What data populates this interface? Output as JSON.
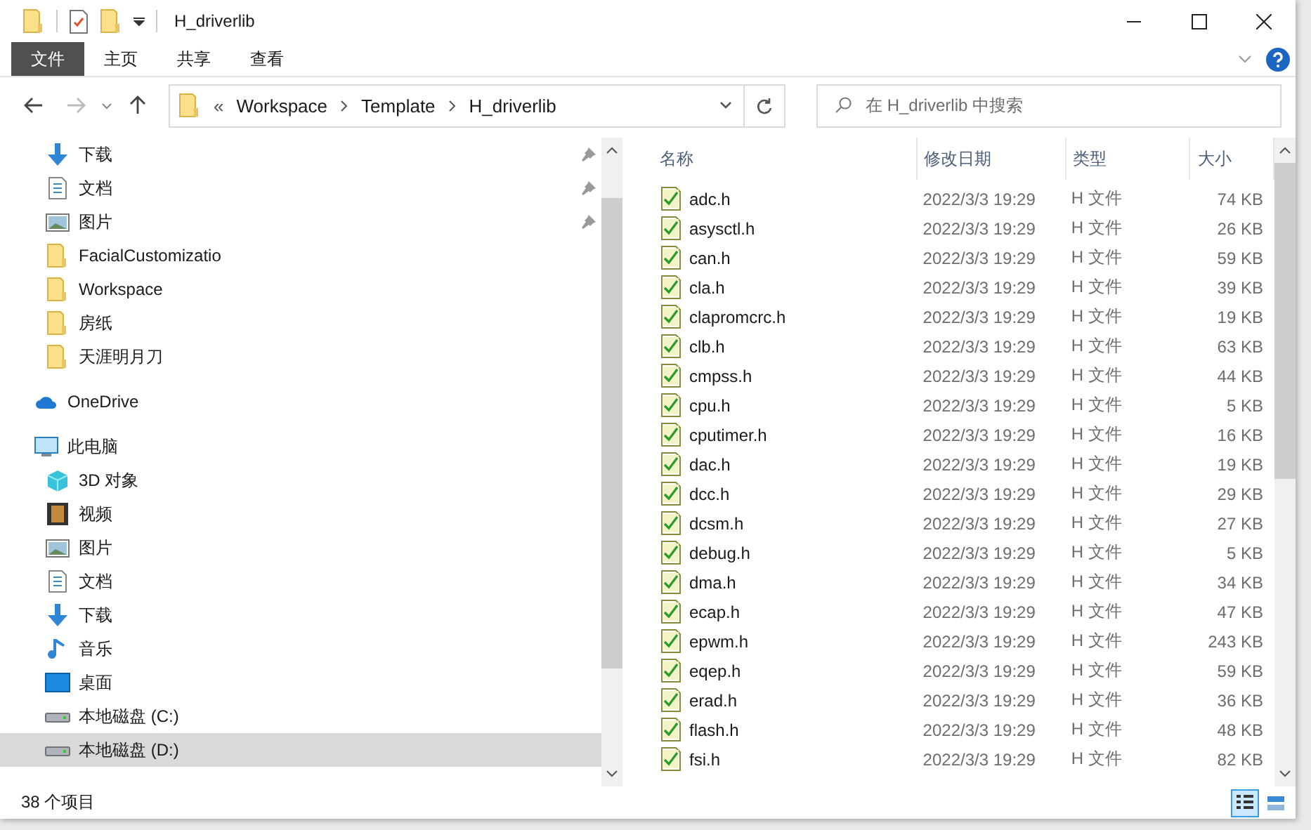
{
  "window": {
    "title": "H_driverlib"
  },
  "ribbon_tabs": [
    {
      "label": "文件",
      "selected": true
    },
    {
      "label": "主页",
      "selected": false
    },
    {
      "label": "共享",
      "selected": false
    },
    {
      "label": "查看",
      "selected": false
    }
  ],
  "address": {
    "overflow": "«",
    "path": [
      "Workspace",
      "Template",
      "H_driverlib"
    ]
  },
  "search": {
    "placeholder": "在 H_driverlib 中搜索"
  },
  "nav": {
    "quick_access": [
      {
        "label": "下载",
        "kind": "download",
        "pinned": true,
        "selected": false
      },
      {
        "label": "文档",
        "kind": "document",
        "pinned": true,
        "selected": false
      },
      {
        "label": "图片",
        "kind": "picture",
        "pinned": true,
        "selected": false
      },
      {
        "label": "FacialCustomizatio",
        "kind": "folder",
        "pinned": false,
        "selected": false
      },
      {
        "label": "Workspace",
        "kind": "folder",
        "pinned": false,
        "selected": false
      },
      {
        "label": "房纸",
        "kind": "folder",
        "pinned": false,
        "selected": false
      },
      {
        "label": "天涯明月刀",
        "kind": "folder",
        "pinned": false,
        "selected": false
      }
    ],
    "roots": [
      {
        "label": "OneDrive",
        "kind": "cloud",
        "pinned": false,
        "selected": false
      },
      {
        "label": "此电脑",
        "kind": "computer",
        "pinned": false,
        "selected": false,
        "children": [
          {
            "label": "3D 对象",
            "kind": "cube",
            "pinned": false,
            "selected": false
          },
          {
            "label": "视频",
            "kind": "video",
            "pinned": false,
            "selected": false
          },
          {
            "label": "图片",
            "kind": "picture",
            "pinned": false,
            "selected": false
          },
          {
            "label": "文档",
            "kind": "document",
            "pinned": false,
            "selected": false
          },
          {
            "label": "下载",
            "kind": "download",
            "pinned": false,
            "selected": false
          },
          {
            "label": "音乐",
            "kind": "music",
            "pinned": false,
            "selected": false
          },
          {
            "label": "桌面",
            "kind": "desktop",
            "pinned": false,
            "selected": false
          },
          {
            "label": "本地磁盘 (C:)",
            "kind": "drive",
            "pinned": false,
            "selected": false
          },
          {
            "label": "本地磁盘 (D:)",
            "kind": "drive",
            "pinned": false,
            "selected": true
          }
        ]
      }
    ]
  },
  "table": {
    "columns": [
      "名称",
      "修改日期",
      "类型",
      "大小"
    ],
    "rows": [
      {
        "name": "adc.h",
        "date": "2022/3/3 19:29",
        "type": "H 文件",
        "size": "74 KB"
      },
      {
        "name": "asysctl.h",
        "date": "2022/3/3 19:29",
        "type": "H 文件",
        "size": "26 KB"
      },
      {
        "name": "can.h",
        "date": "2022/3/3 19:29",
        "type": "H 文件",
        "size": "59 KB"
      },
      {
        "name": "cla.h",
        "date": "2022/3/3 19:29",
        "type": "H 文件",
        "size": "39 KB"
      },
      {
        "name": "clapromcrc.h",
        "date": "2022/3/3 19:29",
        "type": "H 文件",
        "size": "19 KB"
      },
      {
        "name": "clb.h",
        "date": "2022/3/3 19:29",
        "type": "H 文件",
        "size": "63 KB"
      },
      {
        "name": "cmpss.h",
        "date": "2022/3/3 19:29",
        "type": "H 文件",
        "size": "44 KB"
      },
      {
        "name": "cpu.h",
        "date": "2022/3/3 19:29",
        "type": "H 文件",
        "size": "5 KB"
      },
      {
        "name": "cputimer.h",
        "date": "2022/3/3 19:29",
        "type": "H 文件",
        "size": "16 KB"
      },
      {
        "name": "dac.h",
        "date": "2022/3/3 19:29",
        "type": "H 文件",
        "size": "19 KB"
      },
      {
        "name": "dcc.h",
        "date": "2022/3/3 19:29",
        "type": "H 文件",
        "size": "29 KB"
      },
      {
        "name": "dcsm.h",
        "date": "2022/3/3 19:29",
        "type": "H 文件",
        "size": "27 KB"
      },
      {
        "name": "debug.h",
        "date": "2022/3/3 19:29",
        "type": "H 文件",
        "size": "5 KB"
      },
      {
        "name": "dma.h",
        "date": "2022/3/3 19:29",
        "type": "H 文件",
        "size": "34 KB"
      },
      {
        "name": "ecap.h",
        "date": "2022/3/3 19:29",
        "type": "H 文件",
        "size": "47 KB"
      },
      {
        "name": "epwm.h",
        "date": "2022/3/3 19:29",
        "type": "H 文件",
        "size": "243 KB"
      },
      {
        "name": "eqep.h",
        "date": "2022/3/3 19:29",
        "type": "H 文件",
        "size": "59 KB"
      },
      {
        "name": "erad.h",
        "date": "2022/3/3 19:29",
        "type": "H 文件",
        "size": "36 KB"
      },
      {
        "name": "flash.h",
        "date": "2022/3/3 19:29",
        "type": "H 文件",
        "size": "48 KB"
      },
      {
        "name": "fsi.h",
        "date": "2022/3/3 19:29",
        "type": "H 文件",
        "size": "82 KB"
      }
    ]
  },
  "status_bar": {
    "count": "38 个项目"
  },
  "view_buttons": [
    {
      "kind": "details",
      "selected": true
    },
    {
      "kind": "tiles",
      "selected": false
    }
  ]
}
